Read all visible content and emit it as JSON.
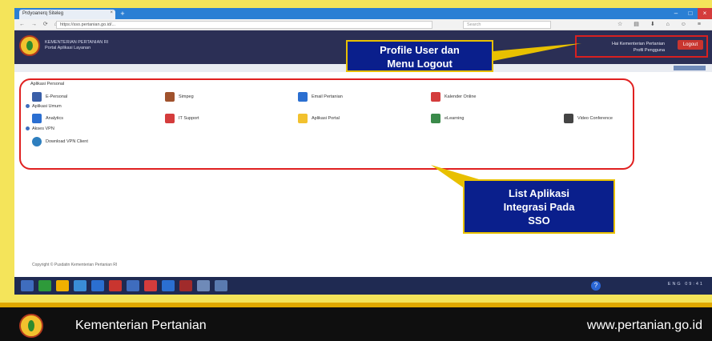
{
  "browser": {
    "tab_title": "Prdyoanerq Siteleg",
    "tab_close": "×",
    "new_tab": "+",
    "window_buttons": [
      "–",
      "□",
      "×"
    ],
    "nav_icons": "← → ⟳ ⌂",
    "url": "https://sso.pertanian.go.id/...",
    "search_placeholder": "Search",
    "toolbar_icons": "☆ ▤ ⬇ ⌂ ☺ ≡"
  },
  "app_header": {
    "title_line1": "KEMENTERIAN PERTANIAN RI",
    "title_line2": "Portal Aplikasi Layanan"
  },
  "profile": {
    "line1": "Hai Kementerian Pertanian",
    "line2": "Profil Pengguna",
    "logout_label": "Logout"
  },
  "callouts": {
    "profile_line1": "Profile User dan",
    "profile_line2": "Menu Logout",
    "apps_line1": "List Aplikasi",
    "apps_line2": "Integrasi Pada",
    "apps_line3": "SSO"
  },
  "sections": {
    "personal": "Aplikasi Personal",
    "umum": "Aplikasi Umum",
    "vpn": "Akses VPN"
  },
  "apps_personal": [
    {
      "label": "E-Personal",
      "color": "#3a5fa8"
    },
    {
      "label": "Simpeg",
      "color": "#a0522d"
    },
    {
      "label": "Email Pertanian",
      "color": "#2b6fd1"
    },
    {
      "label": "Kalender Online",
      "color": "#d43c3c"
    }
  ],
  "apps_umum": [
    {
      "label": "Analytics",
      "color": "#2b6fd1"
    },
    {
      "label": "IT Support",
      "color": "#d43c3c"
    },
    {
      "label": "Aplikasi Portal",
      "color": "#f2c12e"
    },
    {
      "label": "eLearning",
      "color": "#3a8a4a"
    },
    {
      "label": "Video Conference",
      "color": "#444444"
    }
  ],
  "apps_vpn": [
    {
      "label": "Download VPN Client",
      "color": "#2e7fbf"
    }
  ],
  "footer_text": "Copyright © Pusdatin Kementerian Pertanian RI",
  "taskbar": {
    "help": "?",
    "tray": "ENG 09:41",
    "icon_colors": [
      "#3f6dbe",
      "#2e9a3a",
      "#f0b000",
      "#3a8dd6",
      "#2b6fd1",
      "#c9352f",
      "#3f6dbe",
      "#d43c3c",
      "#2b6fd1",
      "#a02b2b",
      "#6f8ab8",
      "#5a7ab0"
    ]
  },
  "bottom_bar": {
    "org_name": "Kementerian Pertanian",
    "website": "www.pertanian.go.id"
  }
}
